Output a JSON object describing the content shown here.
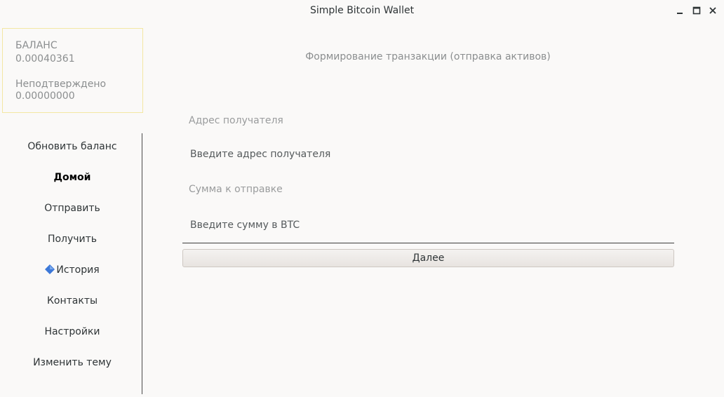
{
  "window": {
    "title": "Simple Bitcoin Wallet",
    "controls": [
      "minimize-icon",
      "maximize-icon",
      "close-icon"
    ]
  },
  "balance": {
    "label": "БАЛАНС",
    "value": "0.00040361",
    "unconfirmed_label": "Неподтверждено",
    "unconfirmed_value": "0.00000000"
  },
  "nav": {
    "items": [
      {
        "label": "Обновить баланс"
      },
      {
        "label": "Домой"
      },
      {
        "label": "Отправить"
      },
      {
        "label": "Получить"
      },
      {
        "label": "История",
        "icon": "diamond-icon"
      },
      {
        "label": "Контакты"
      },
      {
        "label": "Настройки"
      },
      {
        "label": "Изменить тему"
      }
    ],
    "active": "Домой"
  },
  "send": {
    "title": "Формирование транзакции (отправка активов)",
    "address_label": "Адрес получателя",
    "address_placeholder": "Введите адрес получателя",
    "address_value": "",
    "amount_label": "Сумма к отправке",
    "amount_placeholder": "Введите сумму в BTC",
    "amount_value": "",
    "next_label": "Далее"
  },
  "colors": {
    "background": "#faf9f8",
    "balance_border": "#f3e7a3",
    "muted_text": "#8b8e8f",
    "icon_blue": "#3c78d8"
  }
}
